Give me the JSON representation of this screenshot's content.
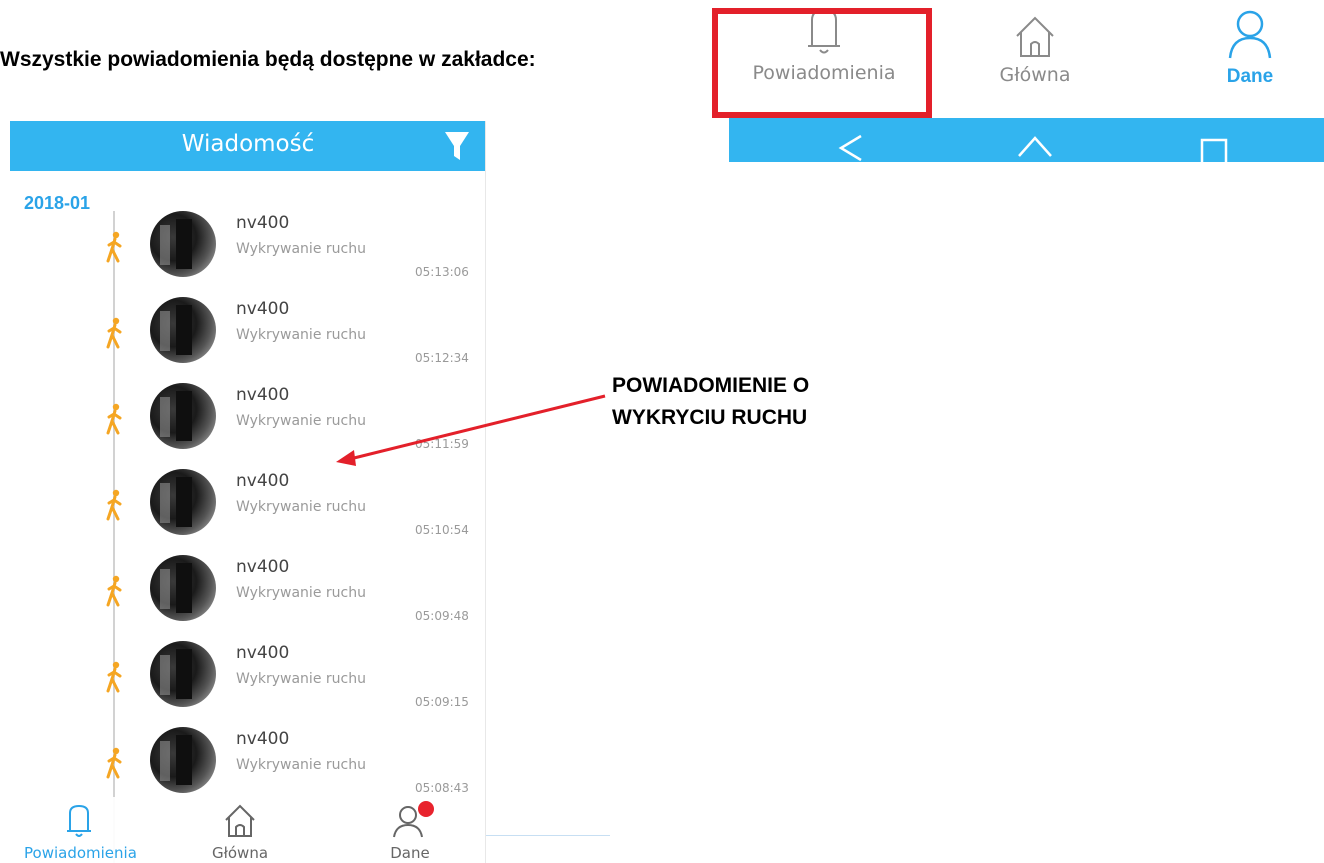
{
  "instruction": "Wszystkie powiadomienia będą dostępne w zakładce:",
  "zoomed_nav": {
    "tabs": [
      {
        "label": "Powiadomienia",
        "icon": "bell-icon",
        "highlighted": true
      },
      {
        "label": "Główna",
        "icon": "home-icon"
      },
      {
        "label": "Dane",
        "icon": "user-icon",
        "active": true
      }
    ],
    "system_buttons": [
      "back-icon",
      "home-outline-icon",
      "recent-apps-icon"
    ]
  },
  "phone": {
    "title": "Wiadomość",
    "filter_icon": "filter-icon",
    "month": "2018-01",
    "events": [
      {
        "name": "nv400",
        "desc": "Wykrywanie ruchu",
        "time": "05:13:06"
      },
      {
        "name": "nv400",
        "desc": "Wykrywanie ruchu",
        "time": "05:12:34"
      },
      {
        "name": "nv400",
        "desc": "Wykrywanie ruchu",
        "time": "05:11:59"
      },
      {
        "name": "nv400",
        "desc": "Wykrywanie ruchu",
        "time": "05:10:54"
      },
      {
        "name": "nv400",
        "desc": "Wykrywanie ruchu",
        "time": "05:09:48"
      },
      {
        "name": "nv400",
        "desc": "Wykrywanie ruchu",
        "time": "05:09:15"
      },
      {
        "name": "nv400",
        "desc": "Wykrywanie ruchu",
        "time": "05:08:43"
      }
    ],
    "bottom_nav": [
      {
        "label": "Powiadomienia",
        "icon": "bell-icon",
        "active": true
      },
      {
        "label": "Główna",
        "icon": "home-icon"
      },
      {
        "label": "Dane",
        "icon": "user-icon",
        "badge": true
      }
    ]
  },
  "annotation": {
    "line1": "POWIADOMIENIE O",
    "line2": "WYKRYCIU RUCHU"
  },
  "colors": {
    "accent": "#33b5f0",
    "highlight_frame": "#e3202a",
    "arrow": "#e3202a",
    "walker": "#f5a623",
    "badge": "#e8232d"
  }
}
